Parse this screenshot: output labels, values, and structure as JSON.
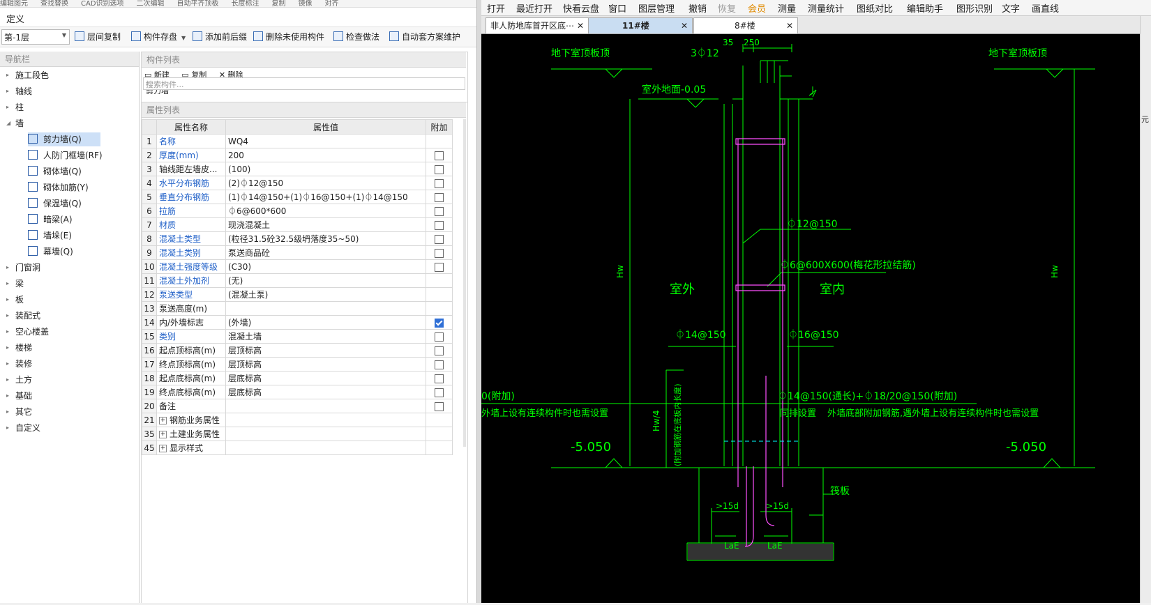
{
  "top_strip": [
    "编辑图元",
    "查找替换",
    "CAD识别选项",
    "二次编辑",
    "自动平齐顶板",
    "长度标注",
    "复制",
    "镜像",
    "对齐"
  ],
  "definition_title": "定义",
  "toolbar": {
    "floor": "第-1层",
    "items": [
      "层间复制",
      "构件存盘",
      "添加前后缀",
      "删除未使用构件",
      "检查做法",
      "自动套方案维护"
    ]
  },
  "nav": {
    "title": "导航栏",
    "items_top": [
      "施工段色",
      "轴线",
      "柱",
      "墙"
    ],
    "wall_children": [
      {
        "label": "剪力墙(Q)",
        "selected": true
      },
      {
        "label": "人防门框墙(RF)",
        "selected": false
      },
      {
        "label": "砌体墙(Q)",
        "selected": false
      },
      {
        "label": "砌体加筋(Y)",
        "selected": false
      },
      {
        "label": "保温墙(Q)",
        "selected": false
      },
      {
        "label": "暗梁(A)",
        "selected": false
      },
      {
        "label": "墙垛(E)",
        "selected": false
      },
      {
        "label": "幕墙(Q)",
        "selected": false
      }
    ],
    "items_bottom": [
      "门窗洞",
      "梁",
      "板",
      "装配式",
      "空心楼盖",
      "楼梯",
      "装修",
      "土方",
      "基础",
      "其它",
      "自定义"
    ]
  },
  "component_list": {
    "title": "构件列表",
    "actions": [
      "新建",
      "复制",
      "删除"
    ],
    "search_placeholder": "搜索构件...",
    "partial_item": "剪力墙"
  },
  "properties": {
    "title": "属性列表",
    "headers": [
      "属性名称",
      "属性值",
      "附加"
    ],
    "rows": [
      {
        "no": "1",
        "name": "名称",
        "value": "WQ4",
        "blue": true,
        "check": "none"
      },
      {
        "no": "2",
        "name": "厚度(mm)",
        "value": "200",
        "blue": true,
        "check": "off"
      },
      {
        "no": "3",
        "name": "轴线距左墙皮...",
        "value": "(100)",
        "blue": false,
        "check": "off"
      },
      {
        "no": "4",
        "name": "水平分布钢筋",
        "value": "(2)⏀12@150",
        "blue": true,
        "check": "off"
      },
      {
        "no": "5",
        "name": "垂直分布钢筋",
        "value": "(1)⏀14@150+(1)⏀16@150+(1)⏀14@150",
        "blue": true,
        "check": "off"
      },
      {
        "no": "6",
        "name": "拉筋",
        "value": "⏀6@600*600",
        "blue": true,
        "check": "off"
      },
      {
        "no": "7",
        "name": "材质",
        "value": "现浇混凝土",
        "blue": true,
        "check": "off"
      },
      {
        "no": "8",
        "name": "混凝土类型",
        "value": "(粒径31.5砼32.5级坍落度35~50)",
        "blue": true,
        "check": "off"
      },
      {
        "no": "9",
        "name": "混凝土类别",
        "value": "泵送商品砼",
        "blue": true,
        "check": "off"
      },
      {
        "no": "10",
        "name": "混凝土强度等级",
        "value": "(C30)",
        "blue": true,
        "check": "off"
      },
      {
        "no": "11",
        "name": "混凝土外加剂",
        "value": "(无)",
        "blue": true,
        "check": "none"
      },
      {
        "no": "12",
        "name": "泵送类型",
        "value": "(混凝土泵)",
        "blue": true,
        "check": "none"
      },
      {
        "no": "13",
        "name": "泵送高度(m)",
        "value": "",
        "blue": false,
        "check": "none"
      },
      {
        "no": "14",
        "name": "内/外墙标志",
        "value": "(外墙)",
        "blue": false,
        "check": "on"
      },
      {
        "no": "15",
        "name": "类别",
        "value": "混凝土墙",
        "blue": true,
        "check": "off"
      },
      {
        "no": "16",
        "name": "起点顶标高(m)",
        "value": "层顶标高",
        "blue": false,
        "check": "off"
      },
      {
        "no": "17",
        "name": "终点顶标高(m)",
        "value": "层顶标高",
        "blue": false,
        "check": "off"
      },
      {
        "no": "18",
        "name": "起点底标高(m)",
        "value": "层底标高",
        "blue": false,
        "check": "off"
      },
      {
        "no": "19",
        "name": "终点底标高(m)",
        "value": "层底标高",
        "blue": false,
        "check": "off"
      },
      {
        "no": "20",
        "name": "备注",
        "value": "",
        "blue": false,
        "check": "off"
      },
      {
        "no": "21",
        "name": "钢筋业务属性",
        "value": "",
        "blue": false,
        "check": "none",
        "group": true
      },
      {
        "no": "35",
        "name": "土建业务属性",
        "value": "",
        "blue": false,
        "check": "none",
        "group": true
      },
      {
        "no": "45",
        "name": "显示样式",
        "value": "",
        "blue": false,
        "check": "none",
        "group": true
      }
    ]
  },
  "cad": {
    "menu": [
      "打开",
      "最近打开",
      "快看云盘",
      "窗口",
      "图层管理",
      "撤销",
      "恢复",
      "会员",
      "测量",
      "测量统计",
      "图纸对比",
      "编辑助手",
      "图形识别",
      "文字",
      "画直线"
    ],
    "tabs": [
      {
        "label": "非人防地库首开区底⋯",
        "active": false
      },
      {
        "label": "11#楼",
        "active": true
      },
      {
        "label": "8#楼",
        "active": false
      }
    ],
    "scroll_label": "元",
    "labels": {
      "top_left": "地下室顶板顶",
      "top_right": "地下室顶板顶",
      "bar_top": "3⏀12",
      "dim_35": "35",
      "dim_250": "250",
      "outdoor_level": "室外地面-0.05",
      "horiz_bar": "⏀12@150",
      "tie_bar": "⏀6@600X600(梅花形拉结筋)",
      "outside": "室外",
      "inside": "室内",
      "hw_left": "Hw",
      "hw_right": "Hw",
      "bar_left": "⏀14@150",
      "bar_right": "⏀16@150",
      "add_left": "0(附加)",
      "add_bar": "⏀14@150(通长)+⏀18/20@150(附加)",
      "note_left": "外墙上设有连续构件时也需设置",
      "note_mid": "同排设置",
      "note_right": "外墙底部附加钢筋,遇外墙上设有连续构件时也需设置",
      "hw4": "Hw/4",
      "vert_note": "(附加钢筋在底板内长度)",
      "lvl_left": "-5.050",
      "lvl_right": "-5.050",
      "raft": "筏板",
      "d15_left": ">15d",
      "d15_right": ">15d",
      "lae_left": "LaE",
      "lae_right": "LaE"
    },
    "colors": {
      "line": "#00ff00",
      "pink": "#ff4fff",
      "cyan": "#00ffff",
      "bg": "#000000"
    }
  }
}
